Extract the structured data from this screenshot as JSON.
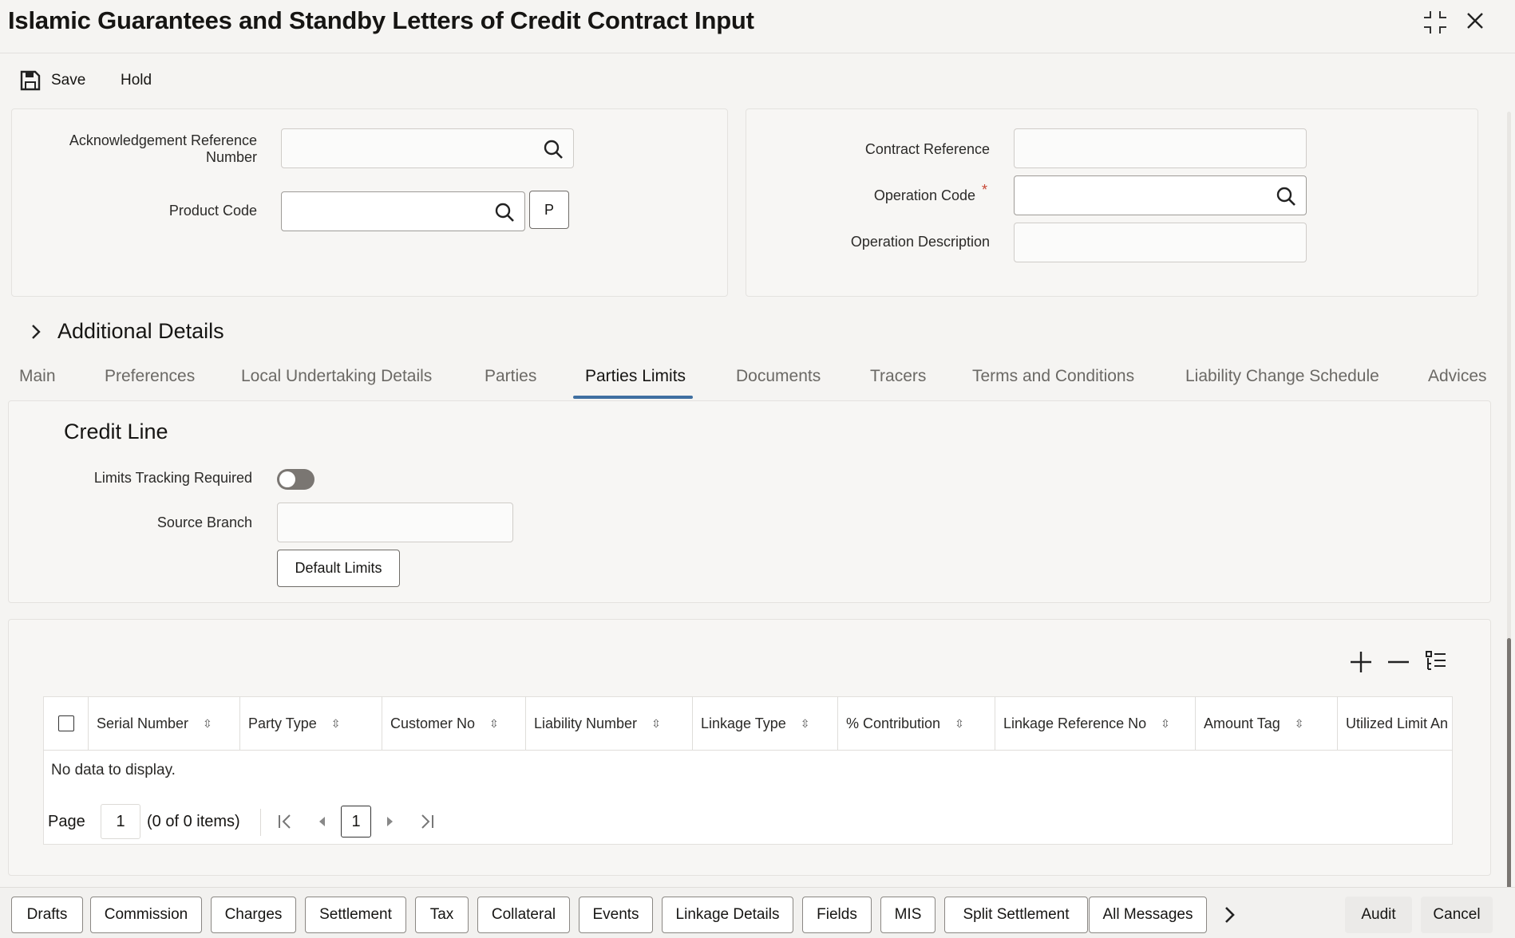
{
  "window": {
    "title": "Islamic Guarantees and Standby Letters of Credit Contract Input"
  },
  "toolbar": {
    "save_label": "Save",
    "hold_label": "Hold"
  },
  "header": {
    "ack_ref_label": "Acknowledgement Reference Number",
    "product_code_label": "Product Code",
    "p_button": "P",
    "contract_ref_label": "Contract Reference",
    "operation_code_label": "Operation Code",
    "required_mark": "*",
    "operation_desc_label": "Operation Description"
  },
  "additional_details": {
    "label": "Additional Details"
  },
  "tabs": [
    {
      "label": "Main"
    },
    {
      "label": "Preferences"
    },
    {
      "label": "Local Undertaking Details"
    },
    {
      "label": "Parties"
    },
    {
      "label": "Parties Limits",
      "selected": true
    },
    {
      "label": "Documents"
    },
    {
      "label": "Tracers"
    },
    {
      "label": "Terms and Conditions"
    },
    {
      "label": "Liability Change Schedule"
    },
    {
      "label": "Advices"
    }
  ],
  "credit_line": {
    "title": "Credit Line",
    "limits_tracking_label": "Limits Tracking Required",
    "limits_tracking_on": false,
    "source_branch_label": "Source Branch",
    "default_limits_button": "Default Limits"
  },
  "grid": {
    "columns": [
      "Serial Number",
      "Party Type",
      "Customer No",
      "Liability Number",
      "Linkage Type",
      "% Contribution",
      "Linkage Reference No",
      "Amount Tag",
      "Utilized Limit An"
    ],
    "empty_text": "No data to display.",
    "pagination": {
      "page_label": "Page",
      "page_value": "1",
      "items_text": "(0 of 0 items)",
      "current_page": "1"
    }
  },
  "bottom_bar": {
    "buttons": [
      "Drafts",
      "Commission",
      "Charges",
      "Settlement",
      "Tax",
      "Collateral",
      "Events",
      "Linkage Details",
      "Fields",
      "MIS",
      "Split Settlement",
      "All Messages"
    ],
    "audit": "Audit",
    "cancel": "Cancel"
  },
  "colors": {
    "accent": "#3f6fa1",
    "required": "#c74634"
  }
}
